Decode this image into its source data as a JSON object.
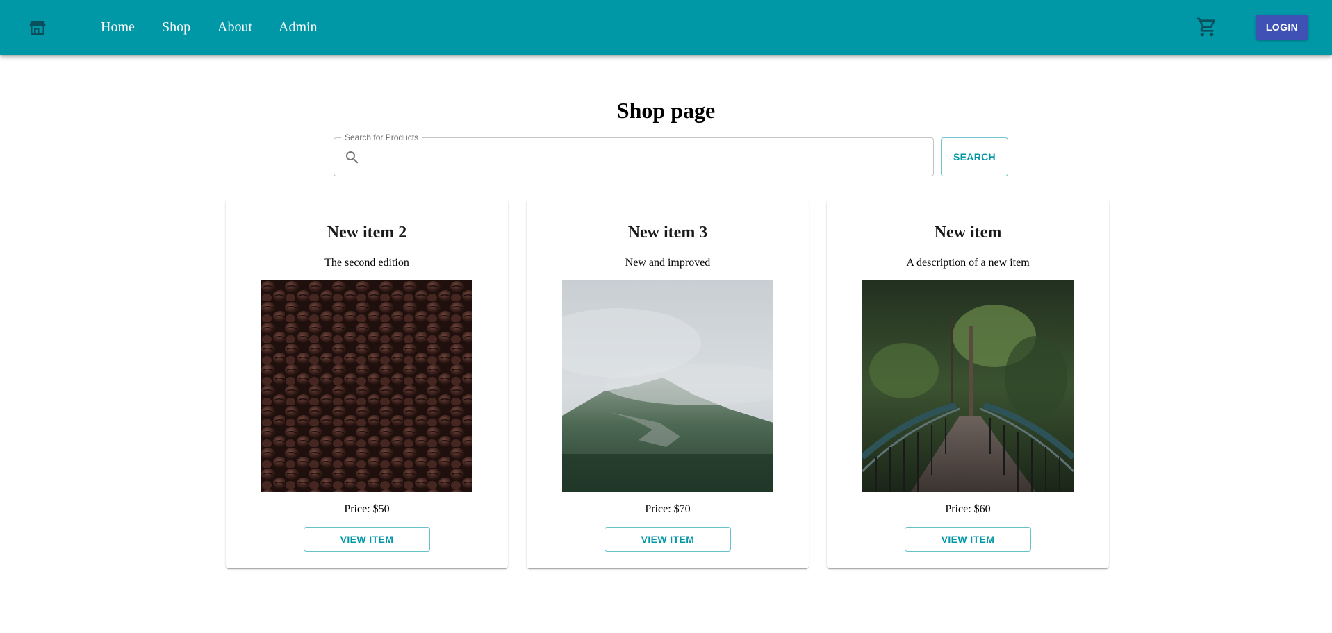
{
  "header": {
    "logo_icon": "storefront-icon",
    "nav": [
      {
        "label": "Home"
      },
      {
        "label": "Shop"
      },
      {
        "label": "About"
      },
      {
        "label": "Admin"
      }
    ],
    "cart_icon": "shopping-cart-icon",
    "login_label": "LOGIN",
    "colors": {
      "appbar": "#0097A7",
      "login": "#3F51B5",
      "icon": "#004d5a"
    }
  },
  "main": {
    "title": "Shop page",
    "search": {
      "label": "Search for Products",
      "value": "",
      "placeholder": "",
      "icon": "search-icon",
      "button_label": "SEARCH"
    }
  },
  "products": [
    {
      "name": "New item 2",
      "description": "The second edition",
      "price": "Price: $50",
      "image": "coffee-beans-photo",
      "button_label": "VIEW ITEM"
    },
    {
      "name": "New item 3",
      "description": "New and improved",
      "price": "Price: $70",
      "image": "misty-mountain-photo",
      "button_label": "VIEW ITEM"
    },
    {
      "name": "New item",
      "description": "A description of a new item",
      "price": "Price: $60",
      "image": "forest-bridge-photo",
      "button_label": "VIEW ITEM"
    }
  ]
}
